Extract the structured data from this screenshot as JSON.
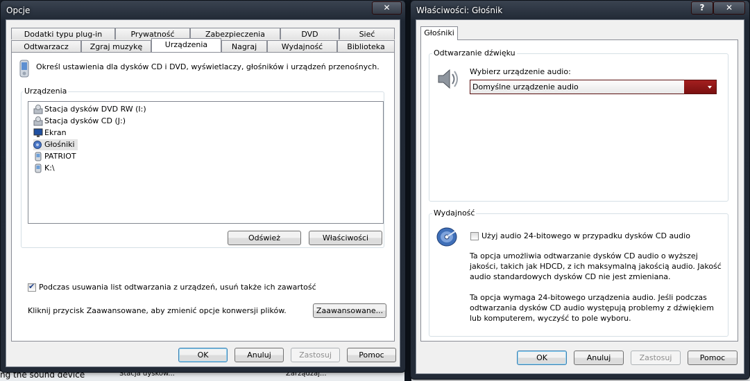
{
  "background": {
    "text_left": "ng the sound device",
    "text_mid1": "Stacja dysków...",
    "text_mid2": "Zarządzaj..."
  },
  "options_window": {
    "title": "Opcje",
    "close_glyph": "✕",
    "tabs_row1": [
      "Dodatki typu plug-in",
      "Prywatność",
      "Zabezpieczenia",
      "DVD",
      "Sieć"
    ],
    "tabs_row2": [
      "Odtwarzacz",
      "Zgraj muzykę",
      "Urządzenia",
      "Nagraj",
      "Wydajność",
      "Biblioteka"
    ],
    "active_tab": "Urządzenia",
    "description": "Określ ustawienia dla dysków CD i DVD, wyświetlaczy, głośników i urządzeń przenośnych.",
    "devices_group_label": "Urządzenia",
    "devices": [
      {
        "label": "Stacja dysków DVD RW (I:)",
        "icon": "dvd-drive-icon"
      },
      {
        "label": "Stacja dysków CD (J:)",
        "icon": "cd-drive-icon"
      },
      {
        "label": "Ekran",
        "icon": "display-icon"
      },
      {
        "label": "Głośniki",
        "icon": "speaker-icon"
      },
      {
        "label": "PATRIOT",
        "icon": "portable-device-icon"
      },
      {
        "label": "K:\\",
        "icon": "portable-device-icon"
      }
    ],
    "selected_device": "Głośniki",
    "refresh_button": "Odśwież",
    "properties_button": "Właściwości",
    "delete_checkbox_label": "Podczas usuwania list odtwarzania z urządzeń, usuń także ich zawartość",
    "delete_checkbox_checked": true,
    "advanced_text": "Kliknij przycisk Zaawansowane, aby zmienić opcje konwersji plików.",
    "advanced_button": "Zaawansowane...",
    "ok_button": "OK",
    "cancel_button": "Anuluj",
    "apply_button": "Zastosuj",
    "help_button": "Pomoc"
  },
  "properties_window": {
    "title": "Właściwości: Głośnik",
    "help_glyph": "?",
    "close_glyph": "✕",
    "tab": "Głośniki",
    "playback_group_label": "Odtwarzanie dźwięku",
    "select_device_label": "Wybierz urządzenie audio:",
    "audio_device_value": "Domyślne urządzenie audio",
    "performance_group_label": "Wydajność",
    "use24_checkbox_label": "Użyj audio 24-bitowego w przypadku dysków CD audio",
    "use24_checked": false,
    "info_para1": "Ta opcja umożliwia odtwarzanie dysków CD audio o wyższej jakości, takich jak HDCD, z ich maksymalną jakością audio. Jakość audio standardowych dysków CD nie jest zmieniana.",
    "info_para2": "Ta opcja wymaga 24-bitowego urządzenia audio. Jeśli podczas odtwarzania dysków CD audio występują problemy z dźwiękiem lub komputerem, wyczyść to pole wyboru.",
    "ok_button": "OK",
    "cancel_button": "Anuluj",
    "apply_button": "Zastosuj",
    "help_button": "Pomoc"
  },
  "colors": {
    "combo_accent": "#8b1a1a",
    "default_button_border": "#3c7fb1"
  }
}
